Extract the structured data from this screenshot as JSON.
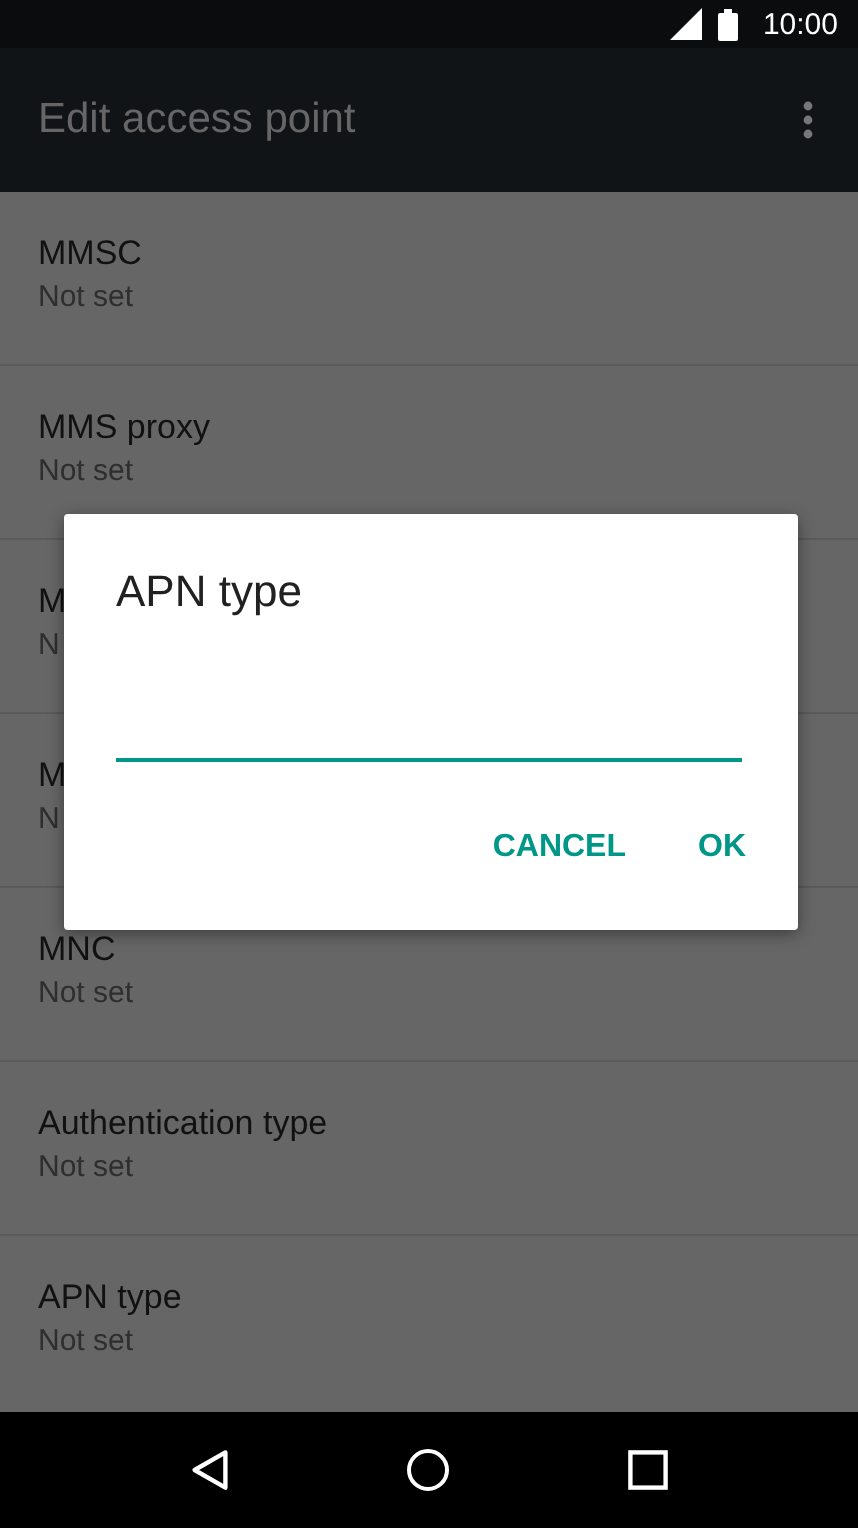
{
  "status_bar": {
    "time": "10:00"
  },
  "app_bar": {
    "title": "Edit access point"
  },
  "settings": [
    {
      "title": "MMSC",
      "value": "Not set"
    },
    {
      "title": "MMS proxy",
      "value": "Not set"
    },
    {
      "title": "M",
      "value": "N"
    },
    {
      "title": "M",
      "value": "N"
    },
    {
      "title": "MNC",
      "value": "Not set"
    },
    {
      "title": "Authentication type",
      "value": "Not set"
    },
    {
      "title": "APN type",
      "value": "Not set"
    }
  ],
  "dialog": {
    "title": "APN type",
    "buttons": [
      "CANCEL",
      "OK"
    ]
  }
}
